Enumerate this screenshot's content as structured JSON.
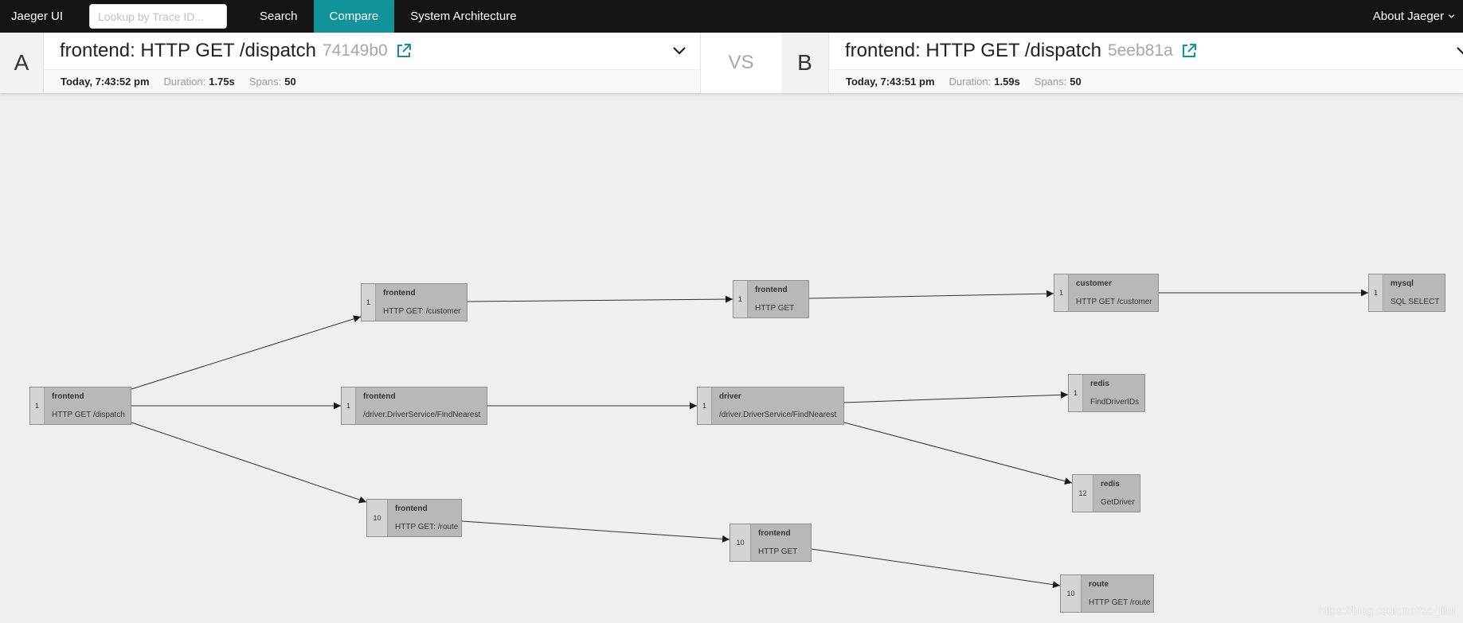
{
  "nav": {
    "brand": "Jaeger UI",
    "lookup_placeholder": "Lookup by Trace ID...",
    "search": "Search",
    "compare": "Compare",
    "system_architecture": "System Architecture",
    "about": "About Jaeger"
  },
  "compare": {
    "vs": "VS",
    "a": {
      "letter": "A",
      "title": "frontend: HTTP GET /dispatch",
      "trace_id": "74149b0",
      "time": "Today, 7:43:52 pm",
      "duration_label": "Duration:",
      "duration": "1.75s",
      "spans_label": "Spans:",
      "spans": "50"
    },
    "b": {
      "letter": "B",
      "title": "frontend: HTTP GET /dispatch",
      "trace_id": "5eeb81a",
      "time": "Today, 7:43:51 pm",
      "duration_label": "Duration:",
      "duration": "1.59s",
      "spans_label": "Spans:",
      "spans": "50"
    }
  },
  "graph": {
    "nodes": [
      {
        "count": "1",
        "service": "frontend",
        "operation": "HTTP GET /dispatch"
      },
      {
        "count": "1",
        "service": "frontend",
        "operation": "HTTP GET: /customer"
      },
      {
        "count": "1",
        "service": "frontend",
        "operation": "/driver.DriverService/FindNearest"
      },
      {
        "count": "10",
        "service": "frontend",
        "operation": "HTTP GET: /route"
      },
      {
        "count": "1",
        "service": "frontend",
        "operation": "HTTP GET"
      },
      {
        "count": "1",
        "service": "driver",
        "operation": "/driver.DriverService/FindNearest"
      },
      {
        "count": "10",
        "service": "frontend",
        "operation": "HTTP GET"
      },
      {
        "count": "1",
        "service": "customer",
        "operation": "HTTP GET /customer"
      },
      {
        "count": "1",
        "service": "redis",
        "operation": "FindDriverIDs"
      },
      {
        "count": "12",
        "service": "redis",
        "operation": "GetDriver"
      },
      {
        "count": "10",
        "service": "route",
        "operation": "HTTP GET /route"
      },
      {
        "count": "1",
        "service": "mysql",
        "operation": "SQL SELECT"
      }
    ]
  },
  "watermark": "https://blog.csdn.net/sc_lilei"
}
